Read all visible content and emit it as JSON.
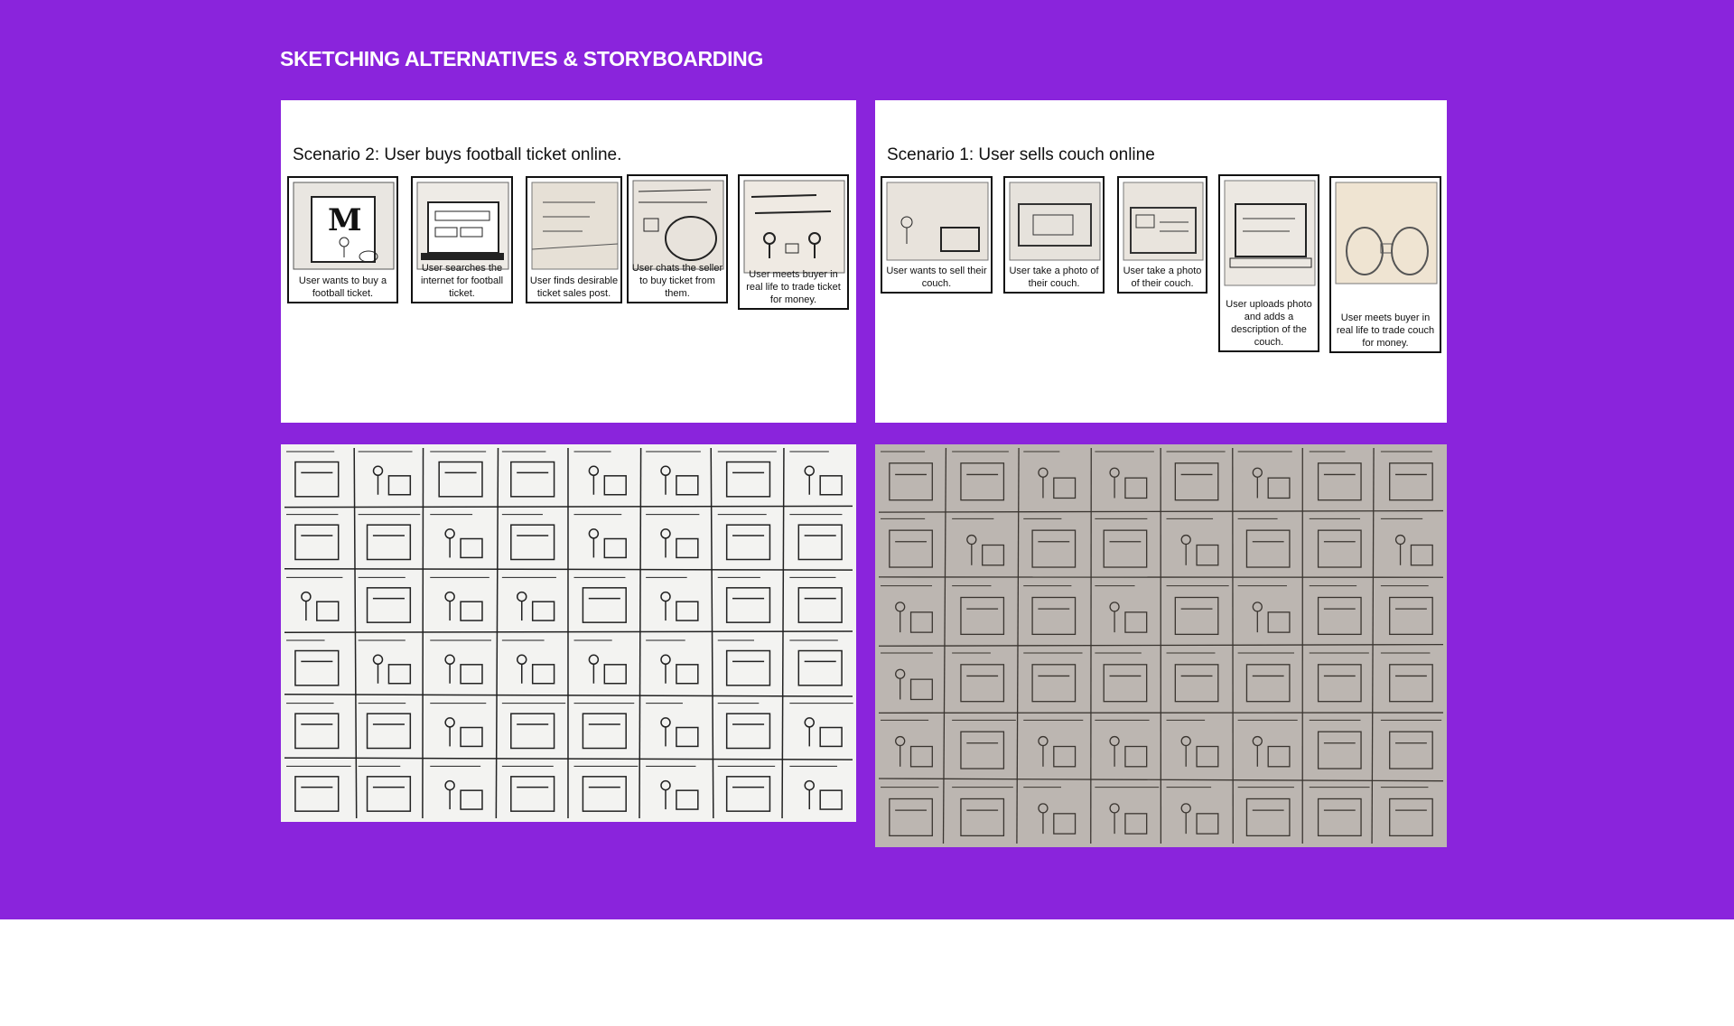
{
  "page": {
    "heading": "SKETCHING ALTERNATIVES & STORYBOARDING",
    "colors": {
      "background": "#8a24dc",
      "panel": "#ffffff",
      "heading": "#ffffff"
    }
  },
  "scenario_left": {
    "title": "Scenario 2: User buys football ticket online.",
    "frames": [
      {
        "caption": "User wants to buy a football ticket."
      },
      {
        "caption": "User searches the internet for football ticket."
      },
      {
        "caption": "User finds desirable ticket sales post."
      },
      {
        "caption": "User chats the seller to buy ticket from them."
      },
      {
        "caption": "User meets buyer in real life to trade ticket for money."
      }
    ]
  },
  "scenario_right": {
    "title": "Scenario 1: User sells couch online",
    "frames": [
      {
        "caption": "User wants to sell their couch."
      },
      {
        "caption": "User take a photo of their couch."
      },
      {
        "caption": "User take a photo of their couch."
      },
      {
        "caption": "User uploads photo and adds a description of the couch."
      },
      {
        "caption": "User meets buyer in real life to trade couch for money."
      }
    ]
  },
  "photos": [
    {
      "name": "sketch-grid-football",
      "description_icon": "sketch-photo-icon"
    },
    {
      "name": "sketch-grid-couch",
      "description_icon": "sketch-photo-icon"
    }
  ]
}
